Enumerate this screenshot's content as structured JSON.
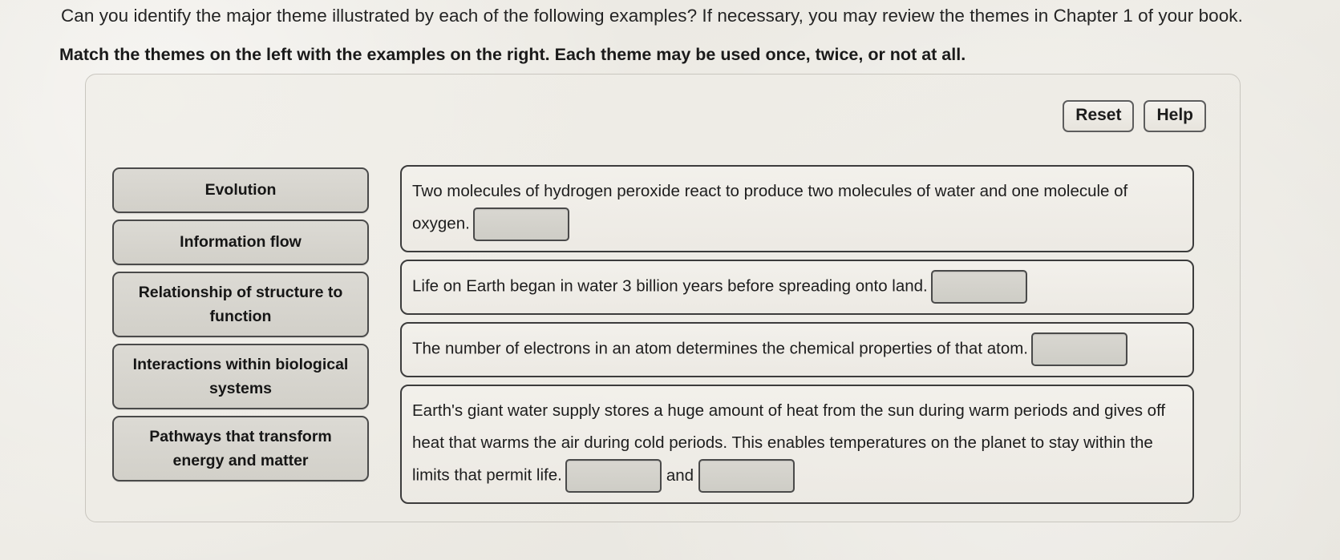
{
  "prompt": "Can you identify the major theme illustrated by each of the following examples? If necessary, you may review the themes in Chapter 1 of your book.",
  "instruction": "Match the themes on the left with the examples on the right. Each theme may be used once, twice, or not at all.",
  "toolbar": {
    "reset_label": "Reset",
    "help_label": "Help"
  },
  "themes": [
    {
      "label": "Evolution"
    },
    {
      "label": "Information flow"
    },
    {
      "label": "Relationship of structure to function"
    },
    {
      "label": "Interactions within biological systems"
    },
    {
      "label": "Pathways that transform energy and matter"
    }
  ],
  "examples": [
    {
      "text_before": "Two molecules of hydrogen peroxide react to produce two molecules of water and one molecule of oxygen.",
      "dropzone_value": "",
      "text_after": ""
    },
    {
      "text_before": "Life on Earth began in water 3 billion years before spreading onto land.",
      "dropzone_value": "",
      "text_after": ""
    },
    {
      "text_before": "The number of electrons in an atom determines the chemical properties of that atom.",
      "dropzone_value": "",
      "text_after": ""
    },
    {
      "text_before": "Earth's giant water supply stores a huge amount of heat from the sun during warm periods and gives off heat that warms the air during cold periods. This enables temperatures on the planet to stay within the limits that permit life.",
      "dropzone_value": "",
      "conjunction": "and",
      "dropzone_value_2": "",
      "text_after": ""
    }
  ],
  "colors": {
    "page_background": "#eceae4",
    "tile_fill": "#d6d4cd",
    "tile_border": "#4a4a4a",
    "card_border": "#3c3c3c",
    "dropzone_fill": "#d4d2cb",
    "text": "#1d1d1d"
  }
}
